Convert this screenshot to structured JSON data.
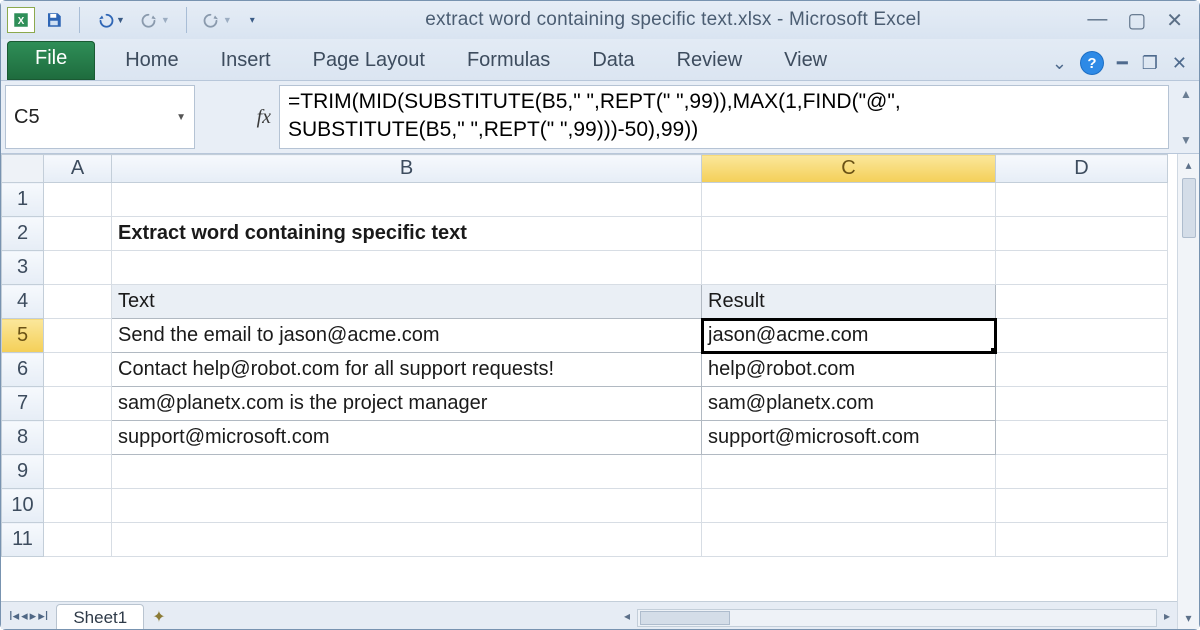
{
  "title": "extract word containing specific text.xlsx  -  Microsoft Excel",
  "fileTab": "File",
  "tabs": [
    "Home",
    "Insert",
    "Page Layout",
    "Formulas",
    "Data",
    "Review",
    "View"
  ],
  "nameBox": "C5",
  "fxLabel": "fx",
  "formulaLine1": "=TRIM(MID(SUBSTITUTE(B5,\" \",REPT(\" \",99)),MAX(1,FIND(\"@\",",
  "formulaLine2": "SUBSTITUTE(B5,\" \",REPT(\" \",99)))-50),99))",
  "cols": [
    "A",
    "B",
    "C",
    "D"
  ],
  "rows": [
    "1",
    "2",
    "3",
    "4",
    "5",
    "6",
    "7",
    "8",
    "9",
    "10",
    "11"
  ],
  "heading": "Extract word containing specific text",
  "table": {
    "headText": "Text",
    "headResult": "Result",
    "data": [
      {
        "text": "Send the email to jason@acme.com",
        "result": "jason@acme.com"
      },
      {
        "text": "Contact help@robot.com for all support requests!",
        "result": "help@robot.com"
      },
      {
        "text": "sam@planetx.com is the project manager",
        "result": "sam@planetx.com"
      },
      {
        "text": "support@microsoft.com",
        "result": "support@microsoft.com"
      }
    ]
  },
  "sheetTab": "Sheet1",
  "selectedCell": "C5"
}
